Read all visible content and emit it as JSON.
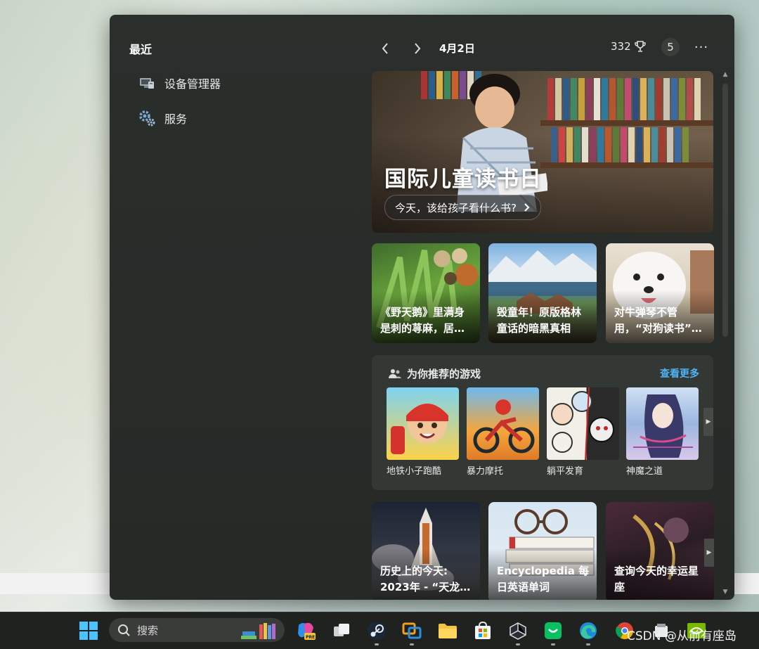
{
  "recent": {
    "title": "最近",
    "items": [
      {
        "label": "设备管理器",
        "icon": "device-manager-icon"
      },
      {
        "label": "服务",
        "icon": "services-gear-icon"
      }
    ]
  },
  "header": {
    "date": "4月2日",
    "points": "332",
    "badge": "5",
    "more": "···"
  },
  "hero": {
    "title": "国际儿童读书日",
    "pill": "今天，该给孩子看什么书?"
  },
  "cards_row1": [
    {
      "caption": "《野天鹅》里满身是刺的荨麻，居…"
    },
    {
      "caption": "毁童年！原版格林童话的暗黑真相"
    },
    {
      "caption": "对牛弹琴不管用，“对狗读书”…"
    }
  ],
  "games": {
    "title": "为你推荐的游戏",
    "more": "查看更多",
    "items": [
      {
        "name": "地铁小子跑酷"
      },
      {
        "name": "暴力摩托"
      },
      {
        "name": "躺平发育"
      },
      {
        "name": "神魔之道"
      }
    ]
  },
  "cards_row2": [
    {
      "caption": "历史上的今天: 2023年 - “天龙…"
    },
    {
      "caption": "Encyclopedia 每日英语单词"
    },
    {
      "caption": "查询今天的幸运星座"
    }
  ],
  "taskbar": {
    "search_placeholder": "搜索",
    "apps": [
      "start-icon",
      "copilot-pre-icon",
      "task-view-icon",
      "steam-icon",
      "remote-desktop-icon",
      "file-explorer-icon",
      "microsoft-store-icon",
      "unity-icon",
      "wechat-icon",
      "edge-icon",
      "chrome-icon",
      "media-icon",
      "nvidia-icon"
    ]
  },
  "watermark": "CSDN @从前有座岛"
}
